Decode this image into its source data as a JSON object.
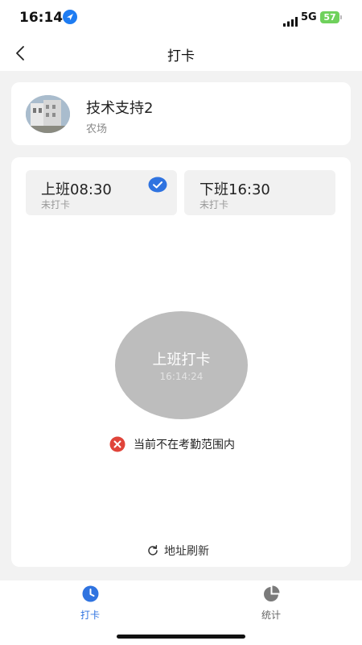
{
  "status_bar": {
    "time": "16:14",
    "network": "5G",
    "battery": "57"
  },
  "nav": {
    "title": "打卡"
  },
  "user": {
    "name": "技术支持2",
    "group": "农场"
  },
  "shifts": [
    {
      "time": "上班08:30",
      "status": "未打卡",
      "selected": true
    },
    {
      "time": "下班16:30",
      "status": "未打卡",
      "selected": false
    }
  ],
  "punch": {
    "label": "上班打卡",
    "clock": "16:14:24"
  },
  "range_message": "当前不在考勤范围内",
  "refresh_label": "地址刷新",
  "tabs": [
    {
      "label": "打卡",
      "icon": "clock-icon",
      "active": true
    },
    {
      "label": "统计",
      "icon": "pie-chart-icon",
      "active": false
    }
  ],
  "colors": {
    "accent": "#2f73e0",
    "error": "#e0443a",
    "punch_button": "#bdbdbd",
    "battery": "#6fd15c"
  }
}
